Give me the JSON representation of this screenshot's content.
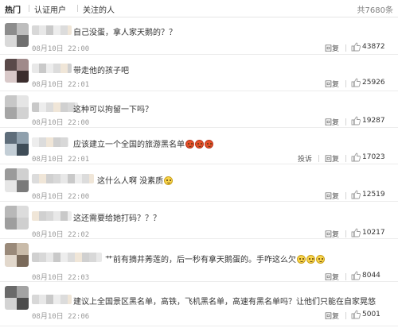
{
  "tabs": [
    {
      "label": "热门"
    },
    {
      "label": "认证用户"
    },
    {
      "label": "关注的人"
    }
  ],
  "total_label": "共7680条",
  "actions": {
    "reply": "回复",
    "report": "投诉"
  },
  "comments": [
    {
      "text": "自己没蛋，拿人家天鹅的？？",
      "time": "08月10日 22:00",
      "likes": "43872",
      "emojis": []
    },
    {
      "text": "带走他的孩子吧",
      "time": "08月10日 22:01",
      "likes": "25926",
      "emojis": []
    },
    {
      "text": "这种可以拘留一下吗？",
      "time": "08月10日 22:00",
      "likes": "19287",
      "emojis": []
    },
    {
      "text": "应该建立一个全国的旅游黑名单",
      "time": "08月10日 22:01",
      "likes": "17023",
      "emojis": [
        "angry-face-icon",
        "angry-face-icon",
        "angry-face-icon"
      ]
    },
    {
      "text": "这什么人啊 没素质",
      "time": "08月10日 22:00",
      "likes": "12519",
      "emojis": [
        "smile-face-icon"
      ]
    },
    {
      "text": "这还需要给她打码？？？",
      "time": "08月10日 22:02",
      "likes": "10217",
      "emojis": []
    },
    {
      "text": "艹前有摘井莠莲的，后一秒有拿天鹅蛋的。手咋这么欠",
      "time": "08月10日 22:03",
      "likes": "8044",
      "emojis": [
        "smile-face-icon",
        "smile-face-icon",
        "smile-face-icon"
      ]
    },
    {
      "text": "建议上全国景区黑名单，高铁，飞机黑名单，高速有黑名单吗？让他们只能在自家晃悠",
      "time": "08月10日 22:06",
      "likes": "5001",
      "emojis": []
    }
  ],
  "colors": {
    "like_icon": "#9a9a9a",
    "time": "#999999",
    "rule": "#ececec"
  }
}
